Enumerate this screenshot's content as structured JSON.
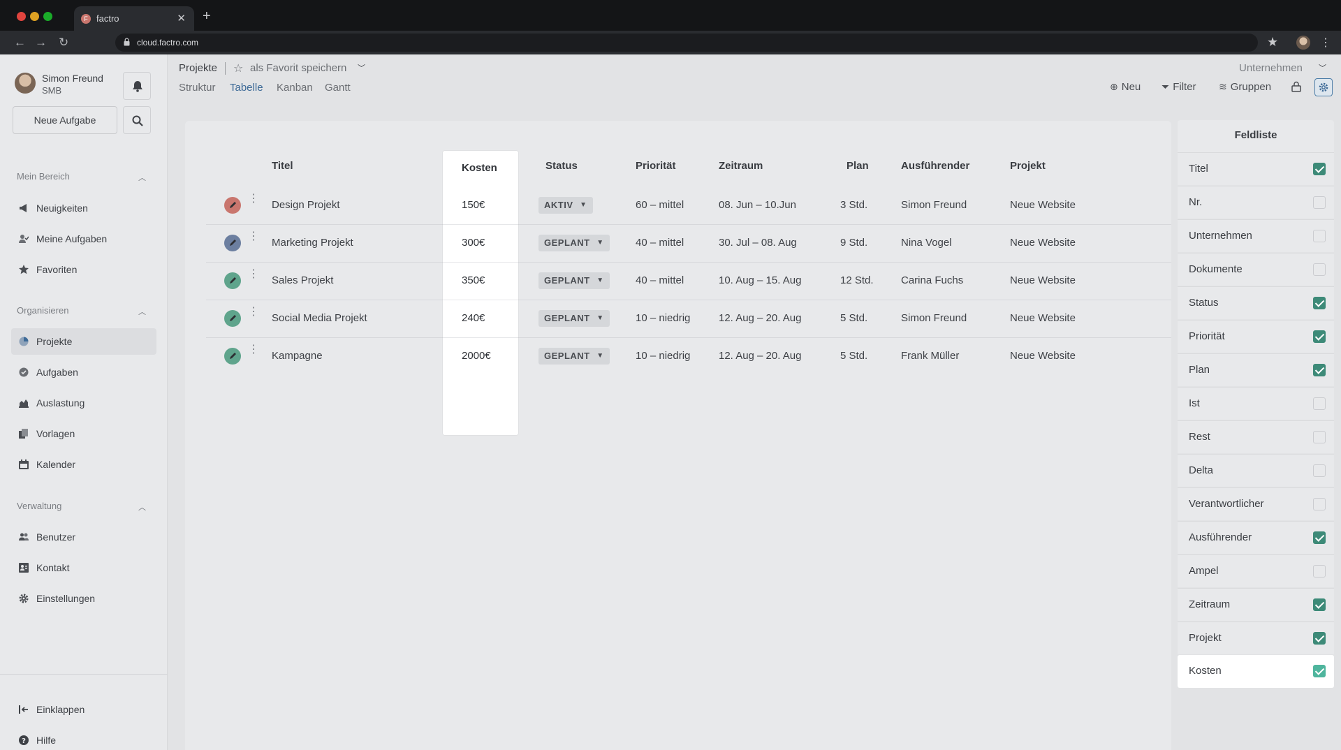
{
  "browser": {
    "tab_title": "factro",
    "tab_favicon": "F",
    "url": "cloud.factro.com"
  },
  "sidebar": {
    "user_name": "Simon Freund",
    "user_org": "SMB",
    "new_task_label": "Neue Aufgabe",
    "sections": {
      "mein_bereich": "Mein Bereich",
      "organisieren": "Organisieren",
      "verwaltung": "Verwaltung"
    },
    "items": [
      {
        "label": "Neuigkeiten",
        "icon": "megaphone-icon"
      },
      {
        "label": "Meine Aufgaben",
        "icon": "user-check-icon"
      },
      {
        "label": "Favoriten",
        "icon": "star-icon"
      },
      {
        "label": "Projekte",
        "icon": "pie-chart-icon",
        "active": true
      },
      {
        "label": "Aufgaben",
        "icon": "check-circle-icon"
      },
      {
        "label": "Auslastung",
        "icon": "bar-chart-icon"
      },
      {
        "label": "Vorlagen",
        "icon": "copy-icon"
      },
      {
        "label": "Kalender",
        "icon": "calendar-icon"
      },
      {
        "label": "Benutzer",
        "icon": "users-icon"
      },
      {
        "label": "Kontakt",
        "icon": "contact-card-icon"
      },
      {
        "label": "Einstellungen",
        "icon": "gear-icon"
      }
    ],
    "collapse_label": "Einklappen",
    "help_label": "Hilfe"
  },
  "header": {
    "breadcrumb": "Projekte",
    "favorite_label": "als Favorit speichern",
    "views": [
      "Struktur",
      "Tabelle",
      "Kanban",
      "Gantt"
    ],
    "active_view": "Tabelle",
    "company_select": "Unternehmen",
    "tools": {
      "new_label": "Neu",
      "filter_label": "Filter",
      "groups_label": "Gruppen"
    }
  },
  "table": {
    "columns": {
      "titel": "Titel",
      "kosten": "Kosten",
      "status": "Status",
      "prioritaet": "Priorität",
      "zeitraum": "Zeitraum",
      "plan": "Plan",
      "ausfuehrender": "Ausführender",
      "projekt": "Projekt"
    },
    "rows": [
      {
        "titel": "Design Projekt",
        "kosten": "150€",
        "status": "AKTIV",
        "prioritaet": "60 – mittel",
        "zeitraum": "08. Jun – 10.Jun",
        "plan": "3 Std.",
        "ausfuehrender": "Simon Freund",
        "projekt": "Neue Website",
        "color": "#c9766e"
      },
      {
        "titel": "Marketing Projekt",
        "kosten": "300€",
        "status": "GEPLANT",
        "prioritaet": "40 – mittel",
        "zeitraum": "30. Jul – 08. Aug",
        "plan": "9 Std.",
        "ausfuehrender": "Nina Vogel",
        "projekt": "Neue Website",
        "color": "#6c7fa0"
      },
      {
        "titel": "Sales Projekt",
        "kosten": "350€",
        "status": "GEPLANT",
        "prioritaet": "40 – mittel",
        "zeitraum": "10. Aug – 15. Aug",
        "plan": "12 Std.",
        "ausfuehrender": "Carina Fuchs",
        "projekt": "Neue Website",
        "color": "#5fa48c"
      },
      {
        "titel": "Social Media Projekt",
        "kosten": "240€",
        "status": "GEPLANT",
        "prioritaet": "10 – niedrig",
        "zeitraum": "12. Aug – 20. Aug",
        "plan": "5 Std.",
        "ausfuehrender": "Simon Freund",
        "projekt": "Neue Website",
        "color": "#5fa48c"
      },
      {
        "titel": "Kampagne",
        "kosten": "2000€",
        "status": "GEPLANT",
        "prioritaet": "10 – niedrig",
        "zeitraum": "12. Aug – 20. Aug",
        "plan": "5 Std.",
        "ausfuehrender": "Frank Müller",
        "projekt": "Neue Website",
        "color": "#5fa48c"
      }
    ]
  },
  "field_list": {
    "title": "Feldliste",
    "fields": [
      {
        "label": "Titel",
        "checked": true
      },
      {
        "label": "Nr.",
        "checked": false
      },
      {
        "label": "Unternehmen",
        "checked": false
      },
      {
        "label": "Dokumente",
        "checked": false
      },
      {
        "label": "Status",
        "checked": true
      },
      {
        "label": "Priorität",
        "checked": true
      },
      {
        "label": "Plan",
        "checked": true
      },
      {
        "label": "Ist",
        "checked": false
      },
      {
        "label": "Rest",
        "checked": false
      },
      {
        "label": "Delta",
        "checked": false
      },
      {
        "label": "Verantwortlicher",
        "checked": false
      },
      {
        "label": "Ausführender",
        "checked": true
      },
      {
        "label": "Ampel",
        "checked": false
      },
      {
        "label": "Zeitraum",
        "checked": true
      },
      {
        "label": "Projekt",
        "checked": true
      },
      {
        "label": "Kosten",
        "checked": true,
        "highlight": true
      }
    ]
  },
  "colors": {
    "accent_blue": "#3d6a97",
    "check_green": "#3d8a78",
    "highlight_green": "#4fb59d"
  }
}
